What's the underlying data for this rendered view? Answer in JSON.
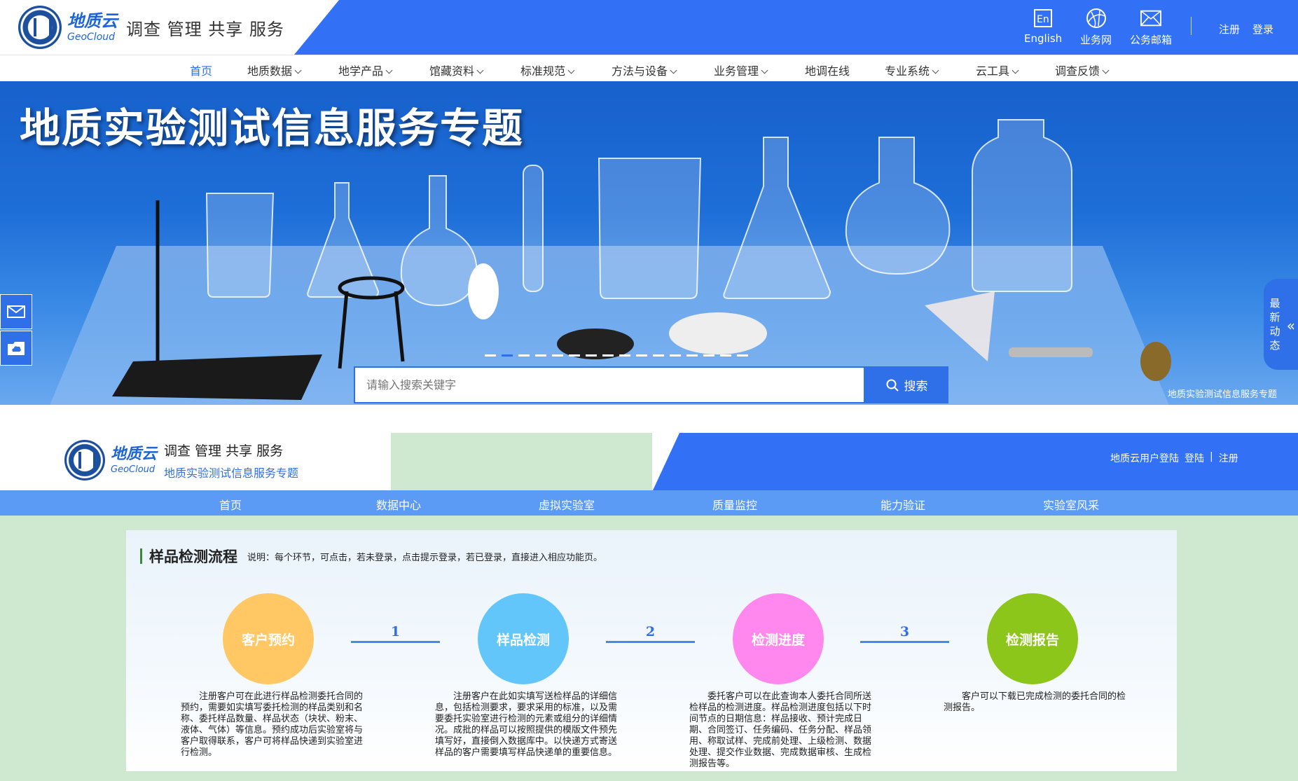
{
  "brand": {
    "name_cn": "地质云",
    "name_en": "GeoCloud",
    "slogan": "调查 管理 共享 服务"
  },
  "top_tools": [
    {
      "label": "English",
      "icon": "english-icon"
    },
    {
      "label": "业务网",
      "icon": "globe-icon"
    },
    {
      "label": "公务邮箱",
      "icon": "mail-icon"
    }
  ],
  "auth": {
    "register": "注册",
    "login": "登录"
  },
  "main_nav": [
    {
      "label": "首页",
      "active": true,
      "dropdown": false
    },
    {
      "label": "地质数据",
      "dropdown": true
    },
    {
      "label": "地学产品",
      "dropdown": true
    },
    {
      "label": "馆藏资料",
      "dropdown": true
    },
    {
      "label": "标准规范",
      "dropdown": true
    },
    {
      "label": "方法与设备",
      "dropdown": true
    },
    {
      "label": "业务管理",
      "dropdown": true
    },
    {
      "label": "地调在线",
      "dropdown": false
    },
    {
      "label": "专业系统",
      "dropdown": true
    },
    {
      "label": "云工具",
      "dropdown": true
    },
    {
      "label": "调查反馈",
      "dropdown": true
    }
  ],
  "banner": {
    "title": "地质实验测试信息服务专题",
    "caption": "地质实验测试信息服务专题",
    "latest_tab": "最新动态",
    "carousel_count": 16,
    "carousel_active": 1
  },
  "search": {
    "placeholder": "请输入搜索关键字",
    "button": "搜索"
  },
  "sub_header": {
    "slogan": "调查 管理 共享 服务",
    "subtitle": "地质实验测试信息服务专题",
    "user_login": "地质云用户登陆",
    "login": "登陆",
    "sep": "|",
    "register": "注册"
  },
  "sub_nav": [
    "首页",
    "数据中心",
    "虚拟实验室",
    "质量监控",
    "能力验证",
    "实验室风采"
  ],
  "process": {
    "title": "样品检测流程",
    "note": "说明：每个环节，可点击，若未登录，点击提示登录，若已登录，直接进入相应功能页。",
    "steps": [
      {
        "label": "客户预约",
        "color": "#ffc864",
        "desc": "注册客户可在此进行样品检测委托合同的预约，需要如实填写委托检测的样品类别和名称、委托样品数量、样品状态（块状、粉末、液体、气体）等信息。预约成功后实验室将与客户取得联系，客户可将样品快递到实验室进行检测。"
      },
      {
        "label": "样品检测",
        "color": "#62c6fb",
        "desc": "注册客户在此如实填写送检样品的详细信息，包括检测要求，要求采用的标准，以及需要委托实验室进行检测的元素或组分的详细情况。成批的样品可以按照提供的模版文件预先填写好，直接倒入数据库中。以快递方式寄送样品的客户需要填写样品快递单的重要信息。"
      },
      {
        "label": "检测进度",
        "color": "#ff88ee",
        "desc": "委托客户可以在此查询本人委托合同所送检样品的检测进度。样品检测进度包括以下时间节点的日期信息：样品接收、预计完成日期、合同签订、任务编码、任务分配、样品领用、称取试样、完成前处理、上级检测、数据处理、提交作业数据、完成数据审核、生成检测报告等。"
      },
      {
        "label": "检测报告",
        "color": "#8cc61a",
        "desc": "客户可以下载已完成检测的委托合同的检测报告。"
      }
    ],
    "connectors": [
      "1",
      "2",
      "3"
    ]
  }
}
